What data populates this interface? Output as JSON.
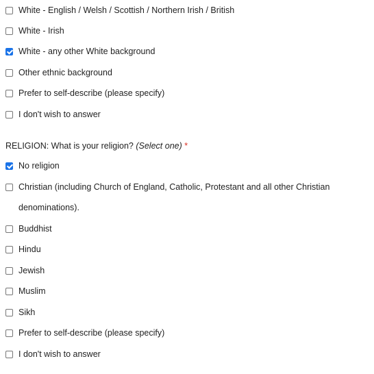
{
  "ethnicity": {
    "options": [
      {
        "label": "White - English / Welsh / Scottish / Northern Irish / British",
        "checked": false
      },
      {
        "label": "White - Irish",
        "checked": false
      },
      {
        "label": "White - any other White background",
        "checked": true
      },
      {
        "label": "Other ethnic background",
        "checked": false
      },
      {
        "label": "Prefer to self-describe (please specify)",
        "checked": false
      },
      {
        "label": "I don't wish to answer",
        "checked": false
      }
    ]
  },
  "religion": {
    "question_label": "RELIGION: What is your religion?",
    "question_hint": "(Select one)",
    "required_marker": "*",
    "options": [
      {
        "label": "No religion",
        "checked": true
      },
      {
        "label": "Christian (including Church of England, Catholic, Protestant and all other Christian denominations).",
        "checked": false
      },
      {
        "label": "Buddhist",
        "checked": false
      },
      {
        "label": "Hindu",
        "checked": false
      },
      {
        "label": "Jewish",
        "checked": false
      },
      {
        "label": "Muslim",
        "checked": false
      },
      {
        "label": "Sikh",
        "checked": false
      },
      {
        "label": "Prefer to self-describe (please specify)",
        "checked": false
      },
      {
        "label": "I don't wish to answer",
        "checked": false
      }
    ]
  },
  "colors": {
    "accent": "#1a73e8",
    "required": "#d93025"
  }
}
